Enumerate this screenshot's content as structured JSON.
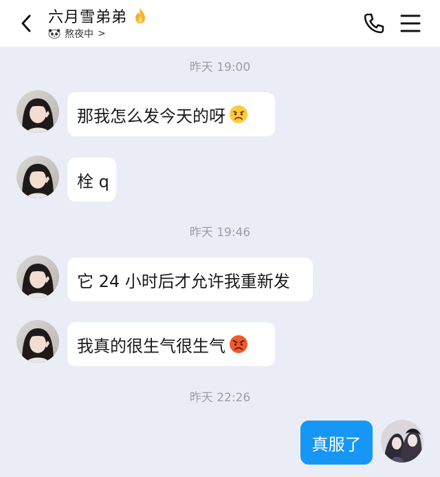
{
  "header": {
    "title": "六月雪弟弟",
    "status": "熬夜中",
    "status_chevron": ">",
    "back_icon": "chevron-left-icon",
    "phone_icon": "phone-icon",
    "menu_icon": "menu-icon",
    "flame_icon": "flame-icon",
    "status_icon": "panda-icon"
  },
  "timestamps": [
    "昨天 19:00",
    "昨天 19:46",
    "昨天 22:26"
  ],
  "messages": [
    {
      "text": "那我怎么发今天的呀",
      "emoji": "frowning-face"
    },
    {
      "text": "栓 q"
    },
    {
      "text": "它 24 小时后才允许我重新发"
    },
    {
      "text": "我真的很生气很生气",
      "emoji": "angry-face"
    }
  ],
  "my_message": {
    "text": "真服了"
  },
  "colors": {
    "background": "#eaedf6",
    "header": "#ffffff",
    "incoming_bubble": "#ffffff",
    "outgoing_bubble": "#1697f6",
    "timestamp": "#9b9ea6"
  }
}
